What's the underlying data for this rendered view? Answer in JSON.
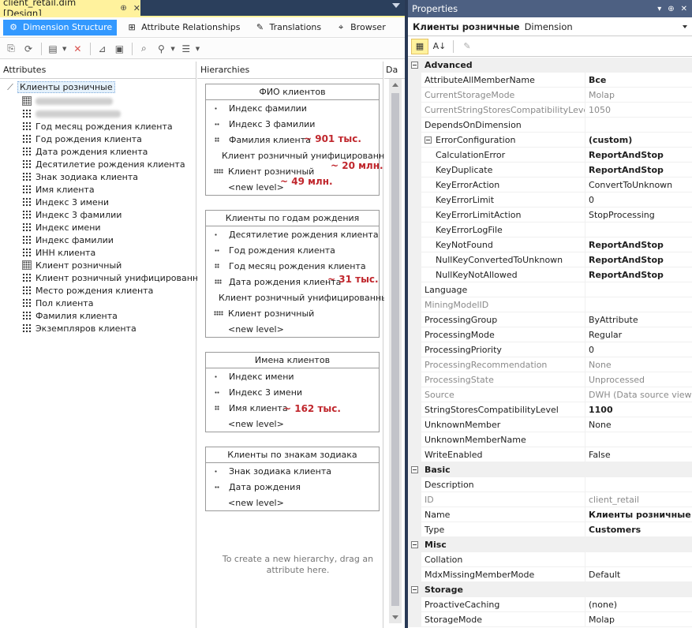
{
  "document_tab": {
    "title": "client_retail.dim [Design]",
    "pin": "⊕",
    "close": "✕"
  },
  "view_tabs": [
    {
      "label": "Dimension Structure",
      "icon": "dimension-structure-icon",
      "glyph": "⚙"
    },
    {
      "label": "Attribute Relationships",
      "icon": "attribute-relationships-icon",
      "glyph": "⊞"
    },
    {
      "label": "Translations",
      "icon": "translations-icon",
      "glyph": "✎"
    },
    {
      "label": "Browser",
      "icon": "browser-icon",
      "glyph": "⌖"
    }
  ],
  "attributes": {
    "header": "Attributes",
    "root": "Клиенты розничные",
    "items": [
      {
        "label": "",
        "blurred": true,
        "icon": "key"
      },
      {
        "label": "",
        "blurred": true,
        "icon": "grid"
      },
      {
        "label": "Год месяц рождения клиента",
        "icon": "grid"
      },
      {
        "label": "Год рождения клиента",
        "icon": "grid"
      },
      {
        "label": "Дата рождения клиента",
        "icon": "grid"
      },
      {
        "label": "Десятилетие рождения клиента",
        "icon": "grid"
      },
      {
        "label": "Знак зодиака клиента",
        "icon": "grid"
      },
      {
        "label": "Имя клиента",
        "icon": "grid"
      },
      {
        "label": "Индекс 3 имени",
        "icon": "grid"
      },
      {
        "label": "Индекс 3 фамилии",
        "icon": "grid"
      },
      {
        "label": "Индекс имени",
        "icon": "grid"
      },
      {
        "label": "Индекс фамилии",
        "icon": "grid"
      },
      {
        "label": "ИНН клиента",
        "icon": "grid"
      },
      {
        "label": "Клиент розничный",
        "icon": "key"
      },
      {
        "label": "Клиент розничный унифицированный",
        "icon": "grid"
      },
      {
        "label": "Место рождения клиента",
        "icon": "grid"
      },
      {
        "label": "Пол клиента",
        "icon": "grid"
      },
      {
        "label": "Фамилия клиента",
        "icon": "grid"
      },
      {
        "label": "Экземпляров клиента",
        "icon": "grid"
      }
    ]
  },
  "hierarchies": {
    "header": "Hierarchies",
    "new_level": "<new level>",
    "hint": "To create a new hierarchy, drag an attribute here.",
    "boxes": [
      {
        "title": "ФИО клиентов",
        "levels": [
          {
            "label": "Индекс фамилии",
            "depth": 1
          },
          {
            "label": "Индекс 3 фамилии",
            "depth": 2
          },
          {
            "label": "Фамилия клиента",
            "depth": 3
          },
          {
            "label": "Клиент розничный унифицированный",
            "depth": 4
          },
          {
            "label": "Клиент розничный",
            "depth": 5
          }
        ],
        "annotations": [
          "~ 901 тыс.",
          "~ 20 млн.",
          "~ 49 млн."
        ]
      },
      {
        "title": "Клиенты по годам рождения",
        "levels": [
          {
            "label": "Десятилетие рождения клиента",
            "depth": 1
          },
          {
            "label": "Год рождения клиента",
            "depth": 2
          },
          {
            "label": "Год месяц рождения клиента",
            "depth": 3
          },
          {
            "label": "Дата рождения клиента",
            "depth": 4
          },
          {
            "label": "Клиент розничный унифицированный",
            "depth": 5
          },
          {
            "label": "Клиент розничный",
            "depth": 5
          }
        ],
        "annotations": [
          "~ 31 тыс."
        ]
      },
      {
        "title": "Имена клиентов",
        "levels": [
          {
            "label": "Индекс имени",
            "depth": 1
          },
          {
            "label": "Индекс 3 имени",
            "depth": 2
          },
          {
            "label": "Имя клиента",
            "depth": 3
          }
        ],
        "annotations": [
          "~ 162 тыс."
        ]
      },
      {
        "title": "Клиенты по знакам зодиака",
        "levels": [
          {
            "label": "Знак зодиака клиента",
            "depth": 1
          },
          {
            "label": "Дата рождения",
            "depth": 2
          }
        ],
        "annotations": []
      }
    ]
  },
  "dsv": {
    "header": "Da"
  },
  "properties": {
    "title": "Properties",
    "object_name": "Клиенты розничные",
    "object_type": "Dimension",
    "rows": [
      {
        "cat": true,
        "name": "Advanced"
      },
      {
        "name": "AttributeAllMemberName",
        "value": "Все",
        "bold": true
      },
      {
        "name": "CurrentStorageMode",
        "value": "Molap",
        "ro": true
      },
      {
        "name": "CurrentStringStoresCompatibilityLevel",
        "value": "1050",
        "ro": true
      },
      {
        "name": "DependsOnDimension",
        "value": ""
      },
      {
        "name": "ErrorConfiguration",
        "value": "(custom)",
        "bold": true,
        "expander": true
      },
      {
        "name": "CalculationError",
        "value": "ReportAndStop",
        "bold": true,
        "indent": true
      },
      {
        "name": "KeyDuplicate",
        "value": "ReportAndStop",
        "bold": true,
        "indent": true
      },
      {
        "name": "KeyErrorAction",
        "value": "ConvertToUnknown",
        "indent": true
      },
      {
        "name": "KeyErrorLimit",
        "value": "0",
        "indent": true
      },
      {
        "name": "KeyErrorLimitAction",
        "value": "StopProcessing",
        "indent": true
      },
      {
        "name": "KeyErrorLogFile",
        "value": "",
        "indent": true
      },
      {
        "name": "KeyNotFound",
        "value": "ReportAndStop",
        "bold": true,
        "indent": true
      },
      {
        "name": "NullKeyConvertedToUnknown",
        "value": "ReportAndStop",
        "bold": true,
        "indent": true
      },
      {
        "name": "NullKeyNotAllowed",
        "value": "ReportAndStop",
        "bold": true,
        "indent": true
      },
      {
        "name": "Language",
        "value": ""
      },
      {
        "name": "MiningModelID",
        "value": "",
        "ro": true
      },
      {
        "name": "ProcessingGroup",
        "value": "ByAttribute"
      },
      {
        "name": "ProcessingMode",
        "value": "Regular"
      },
      {
        "name": "ProcessingPriority",
        "value": "0"
      },
      {
        "name": "ProcessingRecommendation",
        "value": "None",
        "ro": true
      },
      {
        "name": "ProcessingState",
        "value": "Unprocessed",
        "ro": true
      },
      {
        "name": "Source",
        "value": "DWH (Data source view)",
        "ro": true
      },
      {
        "name": "StringStoresCompatibilityLevel",
        "value": "1100",
        "bold": true
      },
      {
        "name": "UnknownMember",
        "value": "None"
      },
      {
        "name": "UnknownMemberName",
        "value": ""
      },
      {
        "name": "WriteEnabled",
        "value": "False"
      },
      {
        "cat": true,
        "name": "Basic"
      },
      {
        "name": "Description",
        "value": ""
      },
      {
        "name": "ID",
        "value": "client_retail",
        "ro": true
      },
      {
        "name": "Name",
        "value": "Клиенты розничные",
        "bold": true
      },
      {
        "name": "Type",
        "value": "Customers",
        "bold": true
      },
      {
        "cat": true,
        "name": "Misc"
      },
      {
        "name": "Collation",
        "value": ""
      },
      {
        "name": "MdxMissingMemberMode",
        "value": "Default"
      },
      {
        "cat": true,
        "name": "Storage"
      },
      {
        "name": "ProactiveCaching",
        "value": "(none)"
      },
      {
        "name": "StorageMode",
        "value": "Molap"
      }
    ]
  },
  "colors": {
    "accent": "#3399ff",
    "tab_active": "#fff29d",
    "annotation": "#c0272d",
    "titlebar": "#4d6082"
  }
}
